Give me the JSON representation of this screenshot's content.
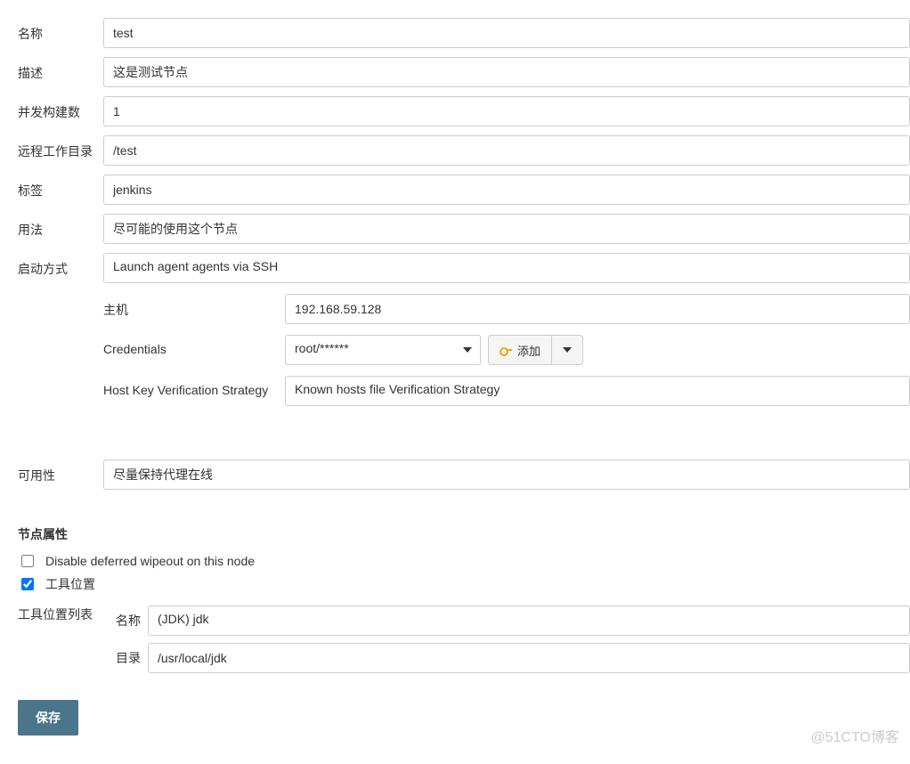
{
  "fields": {
    "name": {
      "label": "名称",
      "value": "test"
    },
    "description": {
      "label": "描述",
      "value": "这是测试节点"
    },
    "executors": {
      "label": "并发构建数",
      "value": "1"
    },
    "remote_dir": {
      "label": "远程工作目录",
      "value": "/test"
    },
    "labels": {
      "label": "标签",
      "value": "jenkins"
    },
    "usage": {
      "label": "用法",
      "value": "尽可能的使用这个节点"
    },
    "launch": {
      "label": "启动方式",
      "value": "Launch agent agents via SSH"
    },
    "availability": {
      "label": "可用性",
      "value": "尽量保持代理在线"
    }
  },
  "ssh": {
    "host": {
      "label": "主机",
      "value": "192.168.59.128"
    },
    "credentials": {
      "label": "Credentials",
      "value": "root/******",
      "add_button": "添加"
    },
    "host_key": {
      "label": "Host Key Verification Strategy",
      "value": "Known hosts file Verification Strategy"
    }
  },
  "node_props": {
    "title": "节点属性",
    "deferred_wipeout": {
      "label": "Disable deferred wipeout on this node",
      "checked": false
    },
    "tool_locations": {
      "label": "工具位置",
      "checked": true
    },
    "tool_list": {
      "label": "工具位置列表",
      "name_label": "名称",
      "name_value": "(JDK) jdk",
      "home_label": "目录",
      "home_value": "/usr/local/jdk"
    }
  },
  "save_button": "保存",
  "watermark": "@51CTO博客"
}
